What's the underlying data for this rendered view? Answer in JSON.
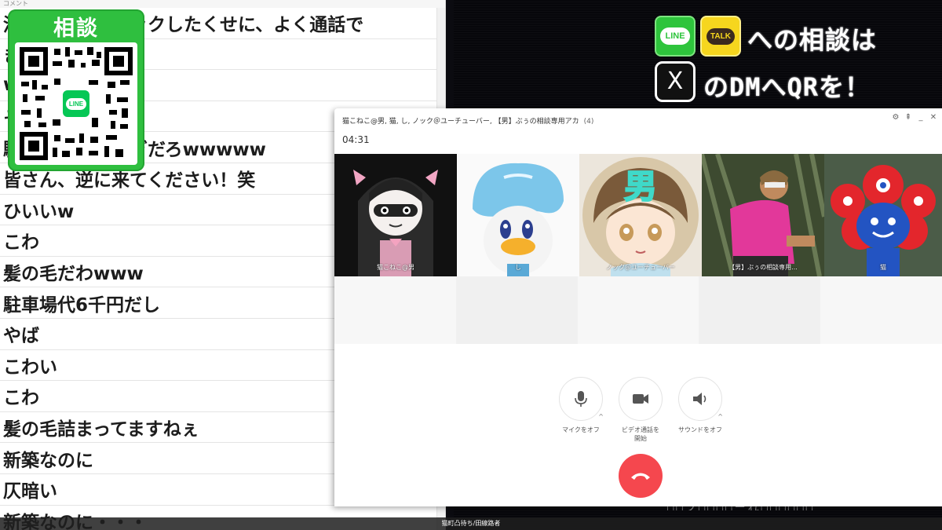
{
  "comments": {
    "header": "コメント",
    "rows": [
      "浮気バレてブロックしたくせに、よく通話で",
      "きるよな",
      "w",
      "そ",
      "駐車場代やばすぎだろwwwww",
      "皆さん、逆に来てください！笑",
      "ひいいw",
      "こわ",
      "髪の毛だわwww",
      "駐車場代6千円だし",
      "やば",
      "こわい",
      "こわ",
      "髪の毛詰まってますねぇ",
      "新築なのに",
      "仄暗い",
      "新築なのに・・・"
    ]
  },
  "qr": {
    "title": "相談",
    "logo": "LINE"
  },
  "banner": {
    "line_badge": "LINE",
    "talk_badge": "TALK",
    "x_badge": "X",
    "line1": "への相談は",
    "line2": "のDMへQRを！",
    "bottom": "□□フ□□□□ーれ□□□□□□"
  },
  "status_bar": {
    "text": "猫町凸待ち/田線路者"
  },
  "call": {
    "title": "猫こねこ@男, 猫, し, ノック＠ユーチューバー, 【男】ぶぅの相談専用アカ",
    "count": "(4)",
    "timer": "04:31",
    "window_controls": [
      "⚙",
      "⇞",
      "_",
      "✕"
    ],
    "participants": [
      {
        "name": "猫こねこ@男",
        "icon": "catgirl-avatar"
      },
      {
        "name": "し",
        "icon": "duck-avatar"
      },
      {
        "name": "ノック＠ユーチューバー",
        "icon": "boy-avatar",
        "badge": "男"
      },
      {
        "name": "【男】ぶぅの相談専用...",
        "icon": "photo-avatar"
      },
      {
        "name": "猫",
        "icon": "mascot-avatar"
      }
    ],
    "controls": {
      "mic_label": "マイクをオフ",
      "video_label_1": "ビデオ通話を",
      "video_label_2": "開始",
      "sound_label": "サウンドをオフ"
    },
    "colors": {
      "hangup": "#f5474e",
      "line_green": "#06c755"
    }
  }
}
